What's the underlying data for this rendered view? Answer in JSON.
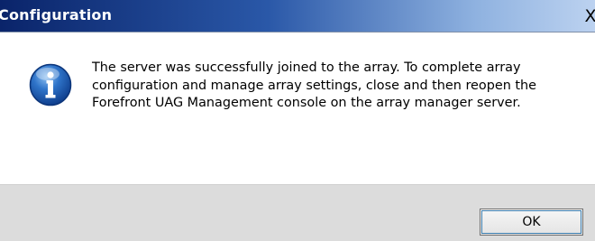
{
  "window": {
    "title": "Configuration",
    "close_glyph": "X",
    "close_icon": "close-icon"
  },
  "dialog": {
    "icon": "information-icon",
    "message": "The server was successfully joined to the array. To complete array configuration and manage array settings, close and then reopen the Forefront UAG Management console on the array manager server."
  },
  "buttons": {
    "ok_label": "OK"
  },
  "colors": {
    "titlebar_start": "#0a246a",
    "titlebar_end": "#bcd2f0",
    "button_area": "#dcdcdc"
  }
}
